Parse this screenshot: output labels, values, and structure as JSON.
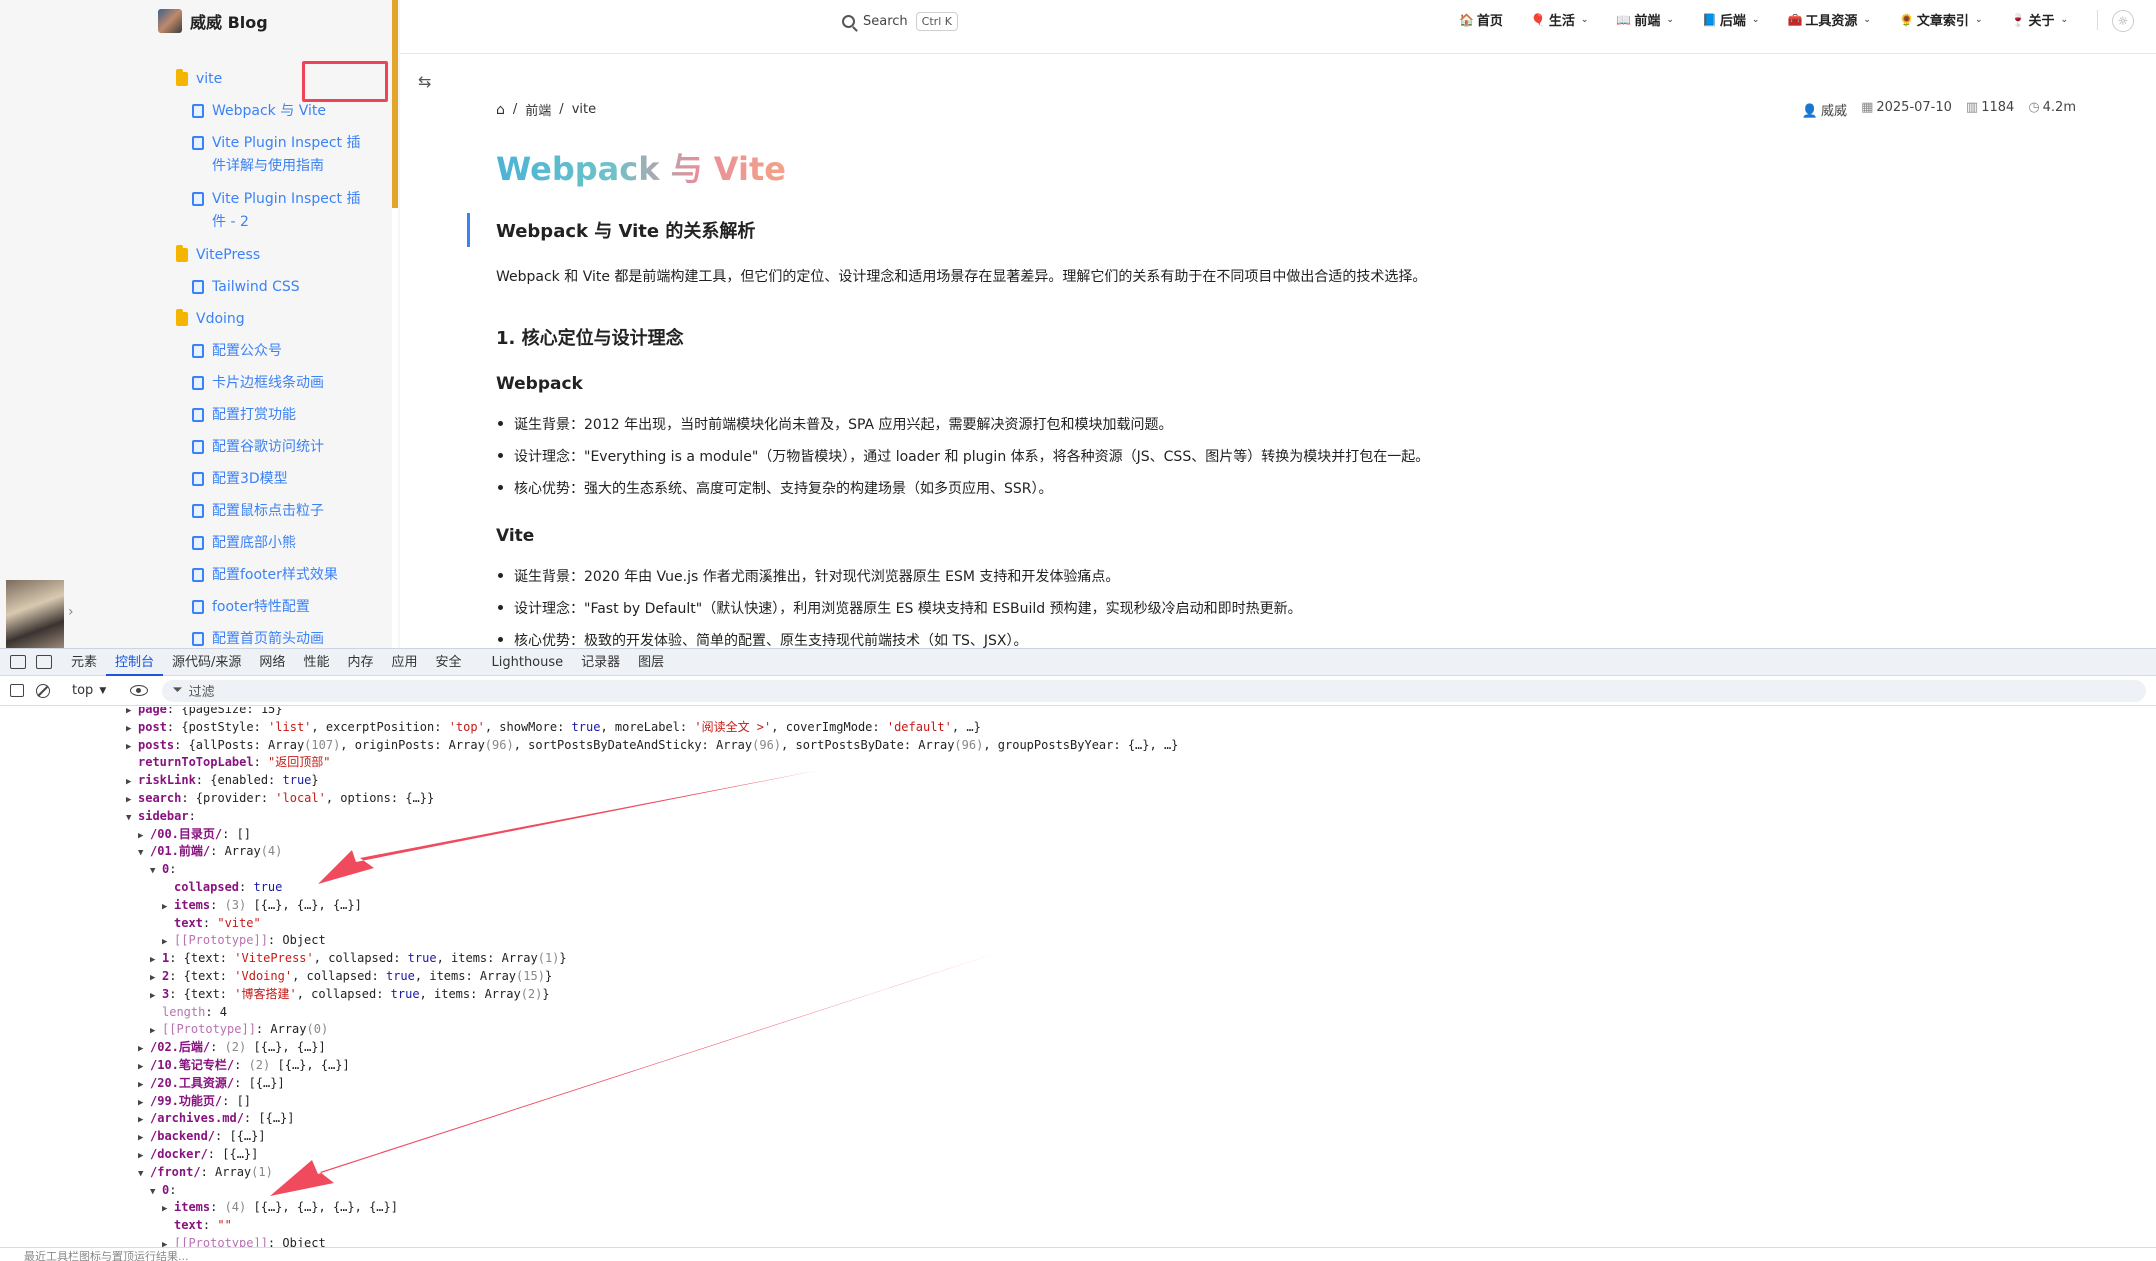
{
  "brand": {
    "name": "威威 Blog"
  },
  "sidebar": {
    "items": [
      {
        "type": "folder",
        "label": "vite"
      },
      {
        "type": "doc",
        "label": "Webpack 与 Vite"
      },
      {
        "type": "doc",
        "label": "Vite Plugin Inspect 插件详解与使用指南"
      },
      {
        "type": "doc",
        "label": "Vite Plugin Inspect 插件 - 2"
      },
      {
        "type": "folder",
        "label": "VitePress"
      },
      {
        "type": "doc",
        "label": "Tailwind CSS"
      },
      {
        "type": "folder",
        "label": "Vdoing"
      },
      {
        "type": "doc",
        "label": "配置公众号"
      },
      {
        "type": "doc",
        "label": "卡片边框线条动画"
      },
      {
        "type": "doc",
        "label": "配置打赏功能"
      },
      {
        "type": "doc",
        "label": "配置谷歌访问统计"
      },
      {
        "type": "doc",
        "label": "配置3D模型"
      },
      {
        "type": "doc",
        "label": "配置鼠标点击粒子"
      },
      {
        "type": "doc",
        "label": "配置底部小熊"
      },
      {
        "type": "doc",
        "label": "配置footer样式效果"
      },
      {
        "type": "doc",
        "label": "footer特性配置"
      },
      {
        "type": "doc",
        "label": "配置首页箭头动画"
      }
    ]
  },
  "search": {
    "label": "Search",
    "shortcut": "Ctrl K"
  },
  "nav": {
    "links": [
      {
        "emoji": "🏠",
        "label": "首页",
        "dropdown": false
      },
      {
        "emoji": "🎈",
        "label": "生活",
        "dropdown": true
      },
      {
        "emoji": "📖",
        "label": "前端",
        "dropdown": true
      },
      {
        "emoji": "📘",
        "label": "后端",
        "dropdown": true
      },
      {
        "emoji": "🧰",
        "label": "工具资源",
        "dropdown": true
      },
      {
        "emoji": "🌻",
        "label": "文章索引",
        "dropdown": true
      },
      {
        "emoji": "🍷",
        "label": "关于",
        "dropdown": true
      }
    ]
  },
  "breadcrumb": {
    "home_icon": "home-icon",
    "sep": "/",
    "parts": [
      "前端",
      "vite"
    ]
  },
  "meta": {
    "author": "威威",
    "date": "2025-07-10",
    "words": "1184",
    "read_time": "4.2m"
  },
  "article": {
    "title": "Webpack 与 Vite",
    "h2": "Webpack 与 Vite 的关系解析",
    "intro": "Webpack 和 Vite 都是前端构建工具，但它们的定位、设计理念和适用场景存在显著差异。理解它们的关系有助于在不同项目中做出合适的技术选择。",
    "h3_core": "1. 核心定位与设计理念",
    "h4_webpack": "Webpack",
    "webpack_bullets": [
      "诞生背景：2012 年出现，当时前端模块化尚未普及，SPA 应用兴起，需要解决资源打包和模块加载问题。",
      "设计理念：\"Everything is a module\"（万物皆模块），通过 loader 和 plugin 体系，将各种资源（JS、CSS、图片等）转换为模块并打包在一起。",
      "核心优势：强大的生态系统、高度可定制、支持复杂的构建场景（如多页应用、SSR）。"
    ],
    "h4_vite": "Vite",
    "vite_bullets": [
      "诞生背景：2020 年由 Vue.js 作者尤雨溪推出，针对现代浏览器原生 ESM 支持和开发体验痛点。",
      "设计理念：\"Fast by Default\"（默认快速），利用浏览器原生 ES 模块支持和 ESBuild 预构建，实现秒级冷启动和即时热更新。",
      "核心优势：极致的开发体验、简单的配置、原生支持现代前端技术（如 TS、JSX）。"
    ]
  },
  "devtools": {
    "tabs": [
      "元素",
      "控制台",
      "源代码/来源",
      "网络",
      "性能",
      "内存",
      "应用",
      "安全",
      "Lighthouse",
      "记录器",
      "图层"
    ],
    "active_tab": "控制台",
    "context": "top",
    "filter_placeholder": "过滤",
    "footer": "最近工具栏图标与置顶运行结果..."
  },
  "console": {
    "lines": [
      {
        "ind": 1,
        "tri": "▶",
        "k": "page",
        "rest": ": {pageSize: 15}"
      },
      {
        "ind": 1,
        "tri": "▶",
        "k": "post",
        "rest": ": {postStyle: 'list', excerptPosition: 'top', showMore: true, moreLabel: '阅读全文 >', coverImgMode: 'default', …}"
      },
      {
        "ind": 1,
        "tri": "▶",
        "k": "posts",
        "rest": ": {allPosts: Array(107), originPosts: Array(96), sortPostsByDateAndSticky: Array(96), sortPostsByDate: Array(96), groupPostsByYear: {…}, …}"
      },
      {
        "ind": 1,
        "tri": "",
        "k": "returnToTopLabel",
        "rest": ": \"返回顶部\""
      },
      {
        "ind": 1,
        "tri": "▶",
        "k": "riskLink",
        "rest": ": {enabled: true}"
      },
      {
        "ind": 1,
        "tri": "▶",
        "k": "search",
        "rest": ": {provider: 'local', options: {…}}"
      },
      {
        "ind": 1,
        "tri": "▼",
        "k": "sidebar",
        "rest": ":"
      },
      {
        "ind": 2,
        "tri": "▶",
        "k": "/00.目录页/",
        "rest": ": []"
      },
      {
        "ind": 2,
        "tri": "▼",
        "k": "/01.前端/",
        "rest": ": Array(4)"
      },
      {
        "ind": 3,
        "tri": "▼",
        "k": "0",
        "rest": ":"
      },
      {
        "ind": 4,
        "tri": "",
        "k": "collapsed",
        "rest": ": true"
      },
      {
        "ind": 4,
        "tri": "▶",
        "k": "items",
        "rest": ": (3) [{…}, {…}, {…}]"
      },
      {
        "ind": 4,
        "tri": "",
        "k": "text",
        "rest": ": \"vite\""
      },
      {
        "ind": 4,
        "tri": "▶",
        "k": "[[Prototype]]",
        "rest": ": Object",
        "dim": true
      },
      {
        "ind": 3,
        "tri": "▶",
        "k": "1",
        "rest": ": {text: 'VitePress', collapsed: true, items: Array(1)}"
      },
      {
        "ind": 3,
        "tri": "▶",
        "k": "2",
        "rest": ": {text: 'Vdoing', collapsed: true, items: Array(15)}"
      },
      {
        "ind": 3,
        "tri": "▶",
        "k": "3",
        "rest": ": {text: '博客搭建', collapsed: true, items: Array(2)}"
      },
      {
        "ind": 3,
        "tri": "",
        "k": "length",
        "rest": ": 4",
        "dim": true
      },
      {
        "ind": 3,
        "tri": "▶",
        "k": "[[Prototype]]",
        "rest": ": Array(0)",
        "dim": true
      },
      {
        "ind": 2,
        "tri": "▶",
        "k": "/02.后端/",
        "rest": ": (2) [{…}, {…}]"
      },
      {
        "ind": 2,
        "tri": "▶",
        "k": "/10.笔记专栏/",
        "rest": ": (2) [{…}, {…}]"
      },
      {
        "ind": 2,
        "tri": "▶",
        "k": "/20.工具资源/",
        "rest": ": [{…}]"
      },
      {
        "ind": 2,
        "tri": "▶",
        "k": "/99.功能页/",
        "rest": ": []"
      },
      {
        "ind": 2,
        "tri": "▶",
        "k": "/archives.md/",
        "rest": ": [{…}]"
      },
      {
        "ind": 2,
        "tri": "▶",
        "k": "/backend/",
        "rest": ": [{…}]"
      },
      {
        "ind": 2,
        "tri": "▶",
        "k": "/docker/",
        "rest": ": [{…}]"
      },
      {
        "ind": 2,
        "tri": "▼",
        "k": "/front/",
        "rest": ": Array(1)"
      },
      {
        "ind": 3,
        "tri": "▼",
        "k": "0",
        "rest": ":"
      },
      {
        "ind": 4,
        "tri": "▶",
        "k": "items",
        "rest": ": (4) [{…}, {…}, {…}, {…}]"
      },
      {
        "ind": 4,
        "tri": "",
        "k": "text",
        "rest": ": \"\""
      },
      {
        "ind": 4,
        "tri": "▶",
        "k": "[[Prototype]]",
        "rest": ": Object",
        "dim": true
      }
    ]
  },
  "colors": {
    "accent": "#3b82f6",
    "annotation": "#ef4456",
    "scrollbar": "#e0a52a"
  }
}
